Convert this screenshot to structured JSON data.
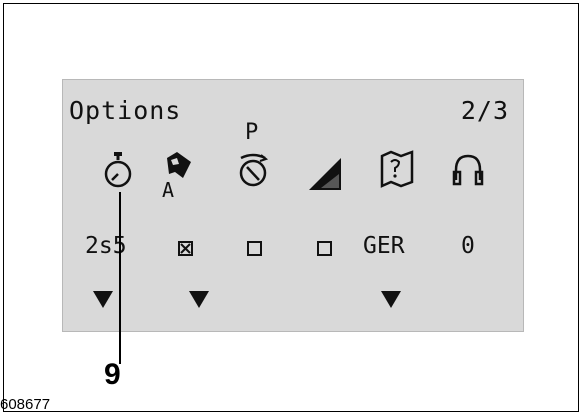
{
  "screen": {
    "title": "Options",
    "page_indicator": "2/3"
  },
  "options": [
    {
      "icon": "stopwatch-icon",
      "sub_label": "",
      "value": "2s5",
      "value_type": "text",
      "has_arrow": true
    },
    {
      "icon": "flash-auto-icon",
      "sub_label": "A",
      "value": "",
      "value_type": "checked-box",
      "has_arrow": true
    },
    {
      "icon": "pre-timer-icon",
      "sub_label": "P",
      "value": "",
      "value_type": "empty-box",
      "has_arrow": false
    },
    {
      "icon": "signal-strength-icon",
      "sub_label": "",
      "value": "",
      "value_type": "empty-box",
      "has_arrow": false
    },
    {
      "icon": "map-language-icon",
      "sub_label": "",
      "value": "GER",
      "value_type": "text",
      "has_arrow": true
    },
    {
      "icon": "headphones-icon",
      "sub_label": "",
      "value": "0",
      "value_type": "text",
      "has_arrow": false
    }
  ],
  "callout": {
    "number": "9"
  },
  "figure_reference": "608677",
  "colors": {
    "lcd_background": "#d9d9d9",
    "ink": "#111111"
  }
}
